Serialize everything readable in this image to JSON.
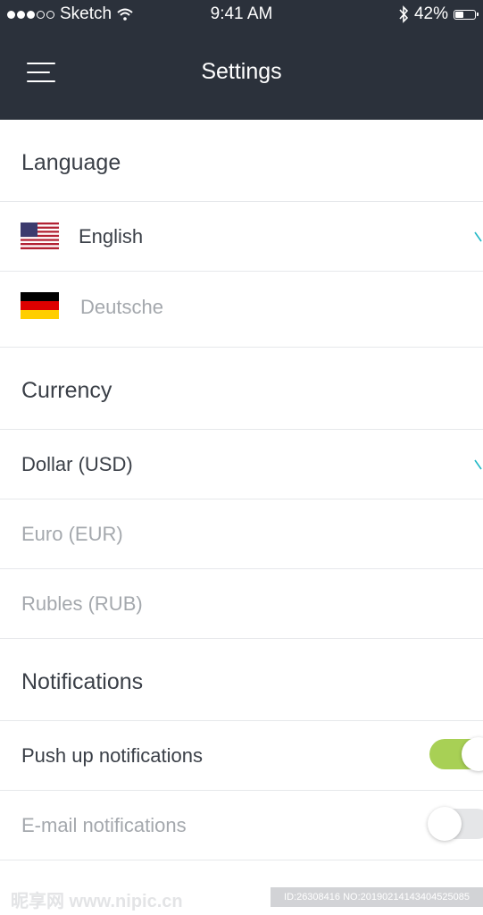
{
  "status_bar": {
    "carrier": "Sketch",
    "time": "9:41 AM",
    "battery_percent": "42%",
    "battery_level": 0.42
  },
  "header": {
    "title": "Settings",
    "menu_icon": "hamburger-menu-icon",
    "background": "#2b313b"
  },
  "language": {
    "heading": "Language",
    "options": [
      {
        "label": "English",
        "flag_icon": "us-flag-icon",
        "selected": true
      },
      {
        "label": "Deutsche",
        "flag_icon": "german-flag-icon",
        "selected": false
      }
    ]
  },
  "currency": {
    "heading": "Currency",
    "options": [
      {
        "label": "Dollar (USD)",
        "selected": true
      },
      {
        "label": "Euro (EUR)",
        "selected": false
      },
      {
        "label": "Rubles (RUB)",
        "selected": false
      }
    ]
  },
  "notifications": {
    "heading": "Notifications",
    "items": [
      {
        "label": "Push up notifications",
        "enabled": true
      },
      {
        "label": "E-mail notifications",
        "enabled": false
      }
    ]
  },
  "watermark": {
    "left": "昵享网 www.nipic.cn",
    "right": "ID:26308416 NO:20190214143404525085"
  },
  "colors": {
    "accent": "#20b8c6",
    "toggle_on": "#a8d055",
    "toggle_off": "#e5e6e8",
    "text_active": "#3a3f47",
    "text_inactive": "#a4a8ad"
  }
}
